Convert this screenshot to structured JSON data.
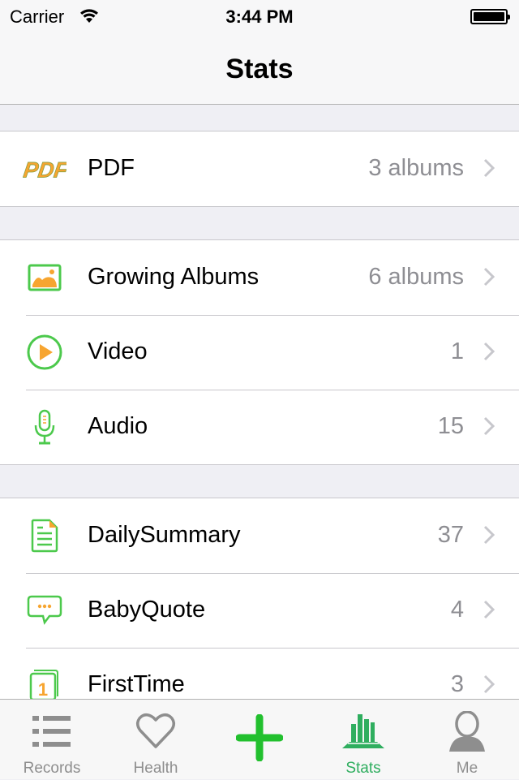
{
  "status_bar": {
    "carrier": "Carrier",
    "time": "3:44 PM"
  },
  "nav": {
    "title": "Stats"
  },
  "sections": [
    {
      "rows": [
        {
          "icon": "pdf-icon",
          "label": "PDF",
          "value": "3 albums"
        }
      ]
    },
    {
      "rows": [
        {
          "icon": "photo-album-icon",
          "label": "Growing Albums",
          "value": "6 albums"
        },
        {
          "icon": "video-play-icon",
          "label": "Video",
          "value": "1"
        },
        {
          "icon": "microphone-icon",
          "label": "Audio",
          "value": "15"
        }
      ]
    },
    {
      "rows": [
        {
          "icon": "document-icon",
          "label": "DailySummary",
          "value": "37"
        },
        {
          "icon": "speech-bubble-icon",
          "label": "BabyQuote",
          "value": "4"
        },
        {
          "icon": "calendar-first-icon",
          "label": "FirstTime",
          "value": "3"
        }
      ]
    }
  ],
  "pdf_icon_text": "PDF",
  "tabbar": {
    "items": [
      {
        "label": "Records",
        "icon": "list-icon",
        "active": false
      },
      {
        "label": "Health",
        "icon": "heart-icon",
        "active": false
      },
      {
        "label": "",
        "icon": "plus-icon",
        "active": false
      },
      {
        "label": "Stats",
        "icon": "bar-chart-icon",
        "active": true
      },
      {
        "label": "Me",
        "icon": "person-icon",
        "active": false
      }
    ]
  },
  "colors": {
    "accent_green": "#2fae5f",
    "icon_green": "#4cc94c",
    "icon_orange": "#f7a530",
    "plus_green": "#22c02e"
  }
}
